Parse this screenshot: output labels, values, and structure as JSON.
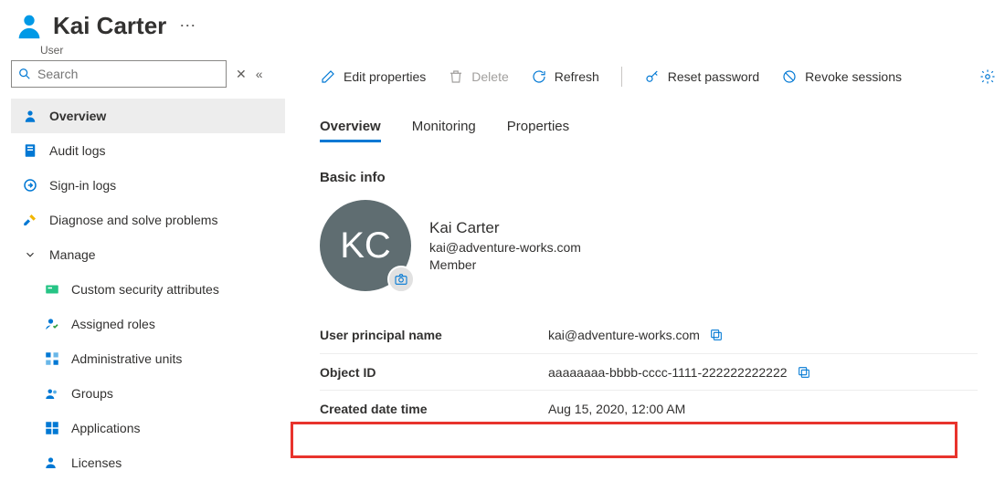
{
  "header": {
    "title": "Kai Carter",
    "subtitle": "User"
  },
  "sidebar": {
    "search_placeholder": "Search",
    "items": [
      {
        "label": "Overview"
      },
      {
        "label": "Audit logs"
      },
      {
        "label": "Sign-in logs"
      },
      {
        "label": "Diagnose and solve problems"
      },
      {
        "label": "Manage"
      },
      {
        "label": "Custom security attributes"
      },
      {
        "label": "Assigned roles"
      },
      {
        "label": "Administrative units"
      },
      {
        "label": "Groups"
      },
      {
        "label": "Applications"
      },
      {
        "label": "Licenses"
      }
    ]
  },
  "commands": {
    "edit": "Edit properties",
    "delete": "Delete",
    "refresh": "Refresh",
    "reset": "Reset password",
    "revoke": "Revoke sessions"
  },
  "tabs": {
    "overview": "Overview",
    "monitoring": "Monitoring",
    "properties": "Properties"
  },
  "basic": {
    "section_title": "Basic info",
    "avatar_initials": "KC",
    "display_name": "Kai Carter",
    "email": "kai@adventure-works.com",
    "member_type": "Member"
  },
  "fields": {
    "upn_label": "User principal name",
    "upn_value": "kai@adventure-works.com",
    "objectid_label": "Object ID",
    "objectid_value": "aaaaaaaa-bbbb-cccc-1111-222222222222",
    "created_label": "Created date time",
    "created_value": "Aug 15, 2020, 12:00 AM"
  }
}
